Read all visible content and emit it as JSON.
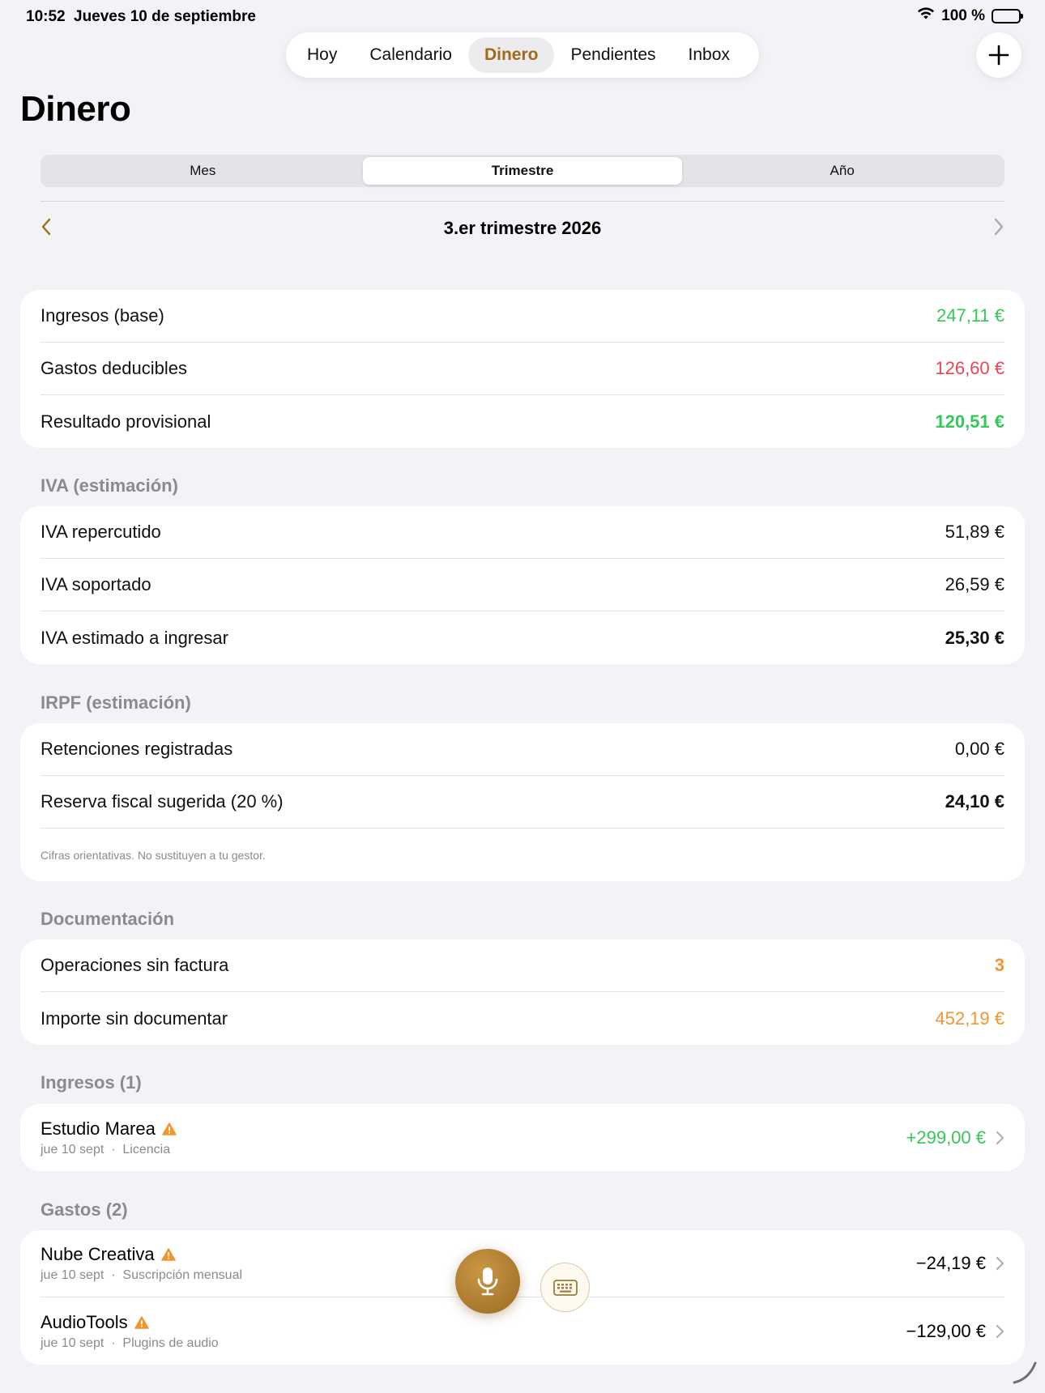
{
  "status_bar": {
    "time": "10:52",
    "date": "Jueves 10 de septiembre",
    "battery": "100 %"
  },
  "nav": {
    "tabs": [
      {
        "label": "Hoy",
        "active": false
      },
      {
        "label": "Calendario",
        "active": false
      },
      {
        "label": "Dinero",
        "active": true
      },
      {
        "label": "Pendientes",
        "active": false
      },
      {
        "label": "Inbox",
        "active": false
      }
    ]
  },
  "page_title": "Dinero",
  "segmented": {
    "options": [
      "Mes",
      "Trimestre",
      "Año"
    ],
    "selected": "Trimestre"
  },
  "period": {
    "label": "3.er trimestre 2026"
  },
  "summary": {
    "rows": [
      {
        "label": "Ingresos (base)",
        "value": "247,11 €"
      },
      {
        "label": "Gastos deducibles",
        "value": "126,60 €"
      },
      {
        "label": "Resultado provisional",
        "value": "120,51 €"
      }
    ]
  },
  "iva": {
    "header": "IVA (estimación)",
    "rows": [
      {
        "label": "IVA repercutido",
        "value": "51,89 €"
      },
      {
        "label": "IVA soportado",
        "value": "26,59 €"
      },
      {
        "label": "IVA estimado a ingresar",
        "value": "25,30 €"
      }
    ]
  },
  "irpf": {
    "header": "IRPF (estimación)",
    "rows": [
      {
        "label": "Retenciones registradas",
        "value": "0,00 €"
      },
      {
        "label": "Reserva fiscal sugerida (20 %)",
        "value": "24,10 €"
      }
    ],
    "note": "Cifras orientativas. No sustituyen a tu gestor."
  },
  "documentacion": {
    "header": "Documentación",
    "rows": [
      {
        "label": "Operaciones sin factura",
        "value": "3"
      },
      {
        "label": "Importe sin documentar",
        "value": "452,19 €"
      }
    ]
  },
  "ingresos": {
    "header": "Ingresos (1)",
    "items": [
      {
        "title": "Estudio Marea",
        "date": "jue 10 sept",
        "category": "Licencia",
        "amount": "+299,00 €"
      }
    ]
  },
  "gastos": {
    "header": "Gastos (2)",
    "items": [
      {
        "title": "Nube Creativa",
        "date": "jue 10 sept",
        "category": "Suscripción mensual",
        "amount": "−24,19 €"
      },
      {
        "title": "AudioTools",
        "date": "jue 10 sept",
        "category": "Plugins de audio",
        "amount": "−129,00 €"
      }
    ]
  },
  "separator": "·",
  "icons": {
    "add": "plus-icon",
    "prev": "chevron-left-icon",
    "next": "chevron-right-icon",
    "warning": "warning-icon",
    "mic": "microphone-icon",
    "keyboard": "keyboard-icon"
  },
  "colors": {
    "accent": "#a06a1a",
    "positive": "#34c759",
    "negative": "#e5484d",
    "warning": "#f0962d"
  }
}
